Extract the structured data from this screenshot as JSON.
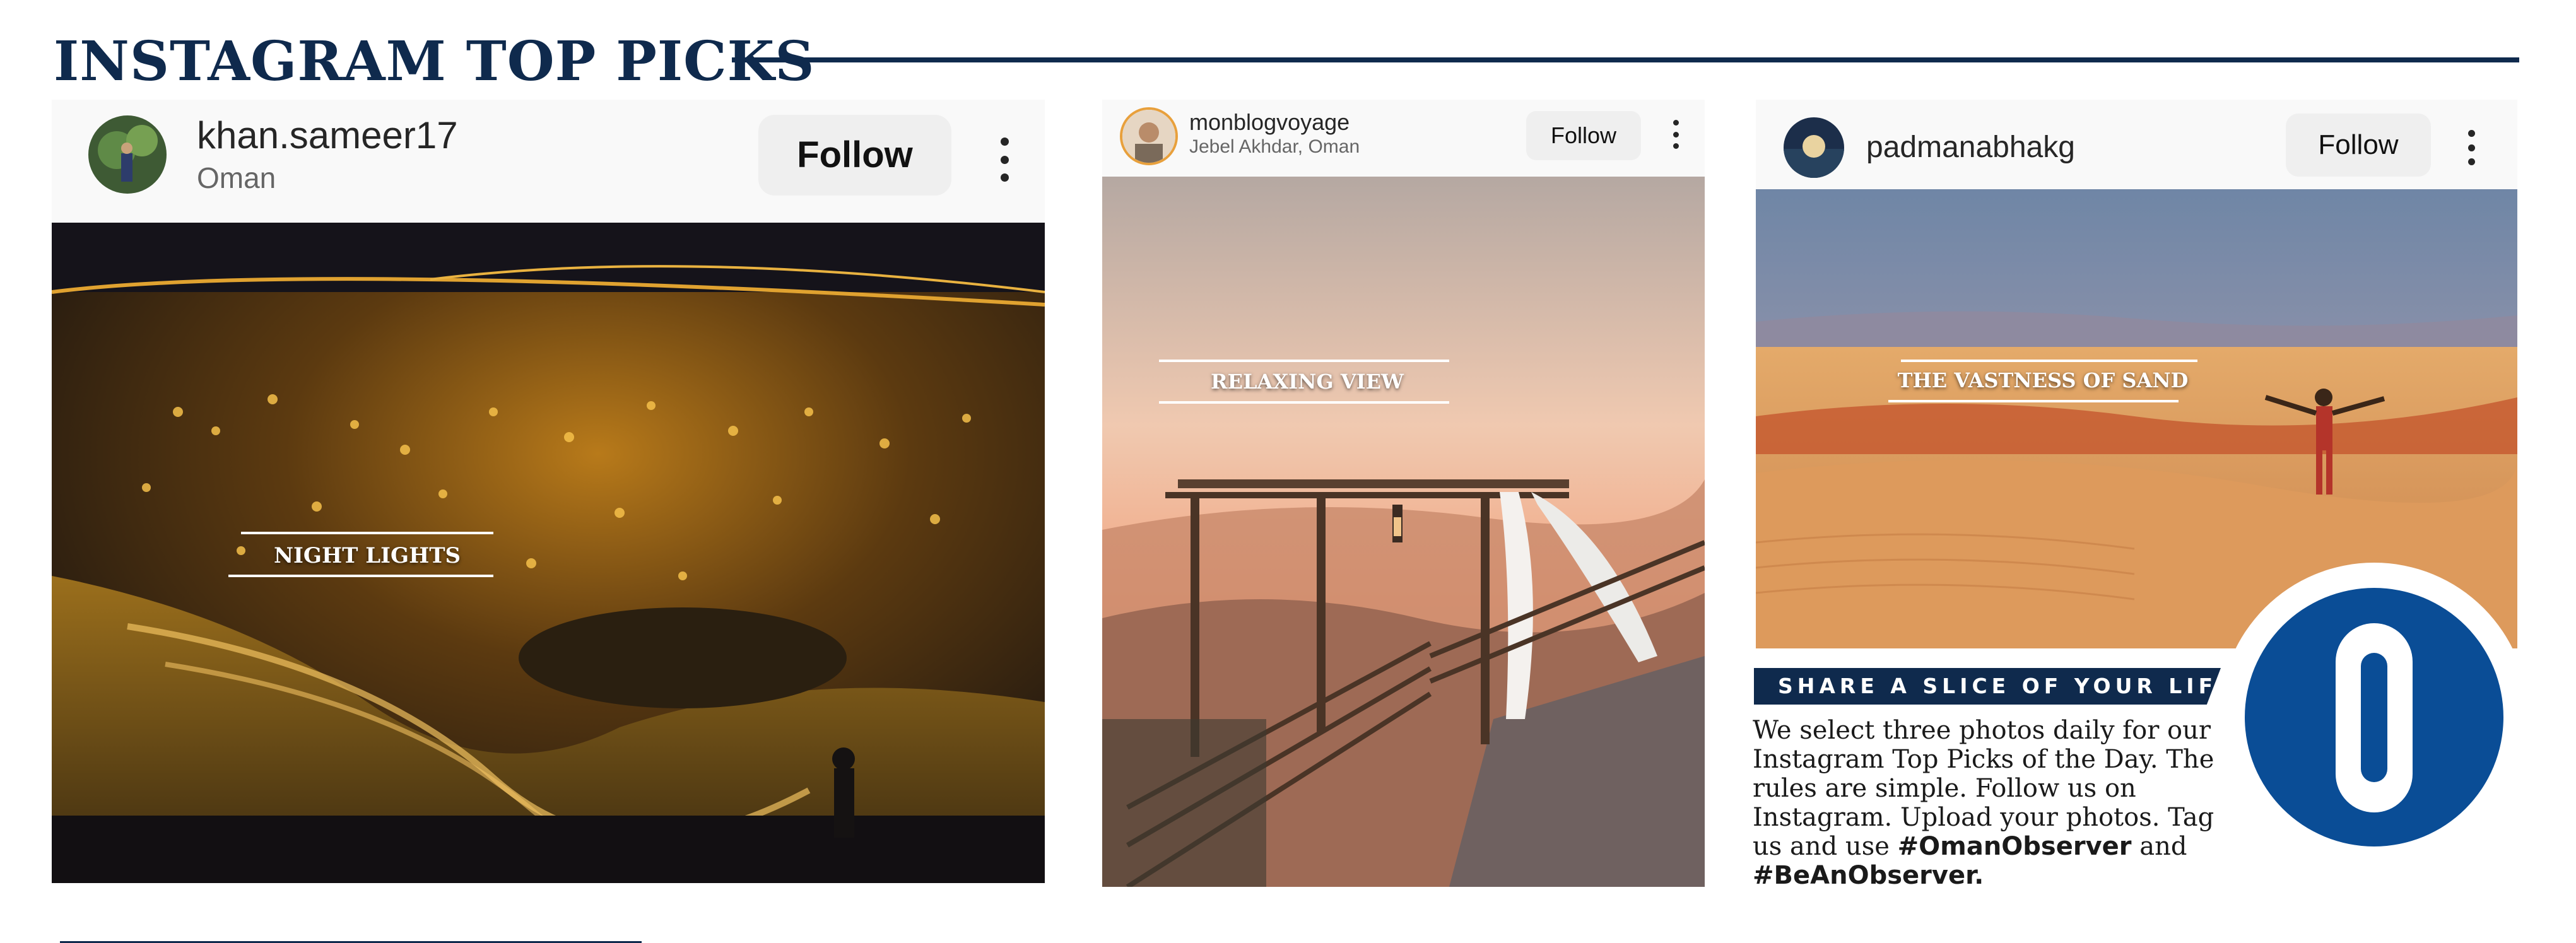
{
  "header": {
    "title": "INSTAGRAM TOP PICKS"
  },
  "posts": [
    {
      "username": "khan.sameer17",
      "location": "Oman",
      "follow_label": "Follow",
      "caption": "NIGHT LIGHTS"
    },
    {
      "username": "monblogvoyage",
      "location": "Jebel Akhdar, Oman",
      "follow_label": "Follow",
      "caption": "RELAXING VIEW"
    },
    {
      "username": "padmanabhakg",
      "location": "",
      "follow_label": "Follow",
      "caption": "THE VASTNESS OF SAND"
    }
  ],
  "promo": {
    "banner": "SHARE A SLICE OF YOUR LIFE",
    "body": "We select three photos daily for our Instagram Top Picks of the Day. The rules are simple. Follow us on Instagram. Upload your photos. Tag us and use",
    "hashtag1": "#OmanObserver",
    "connector": "and",
    "hashtag2": "#BeAnObserver.",
    "logo_letter": "O"
  },
  "colors": {
    "navy": "#0f2a4d",
    "logo_blue": "#0a4d96",
    "follow_bg": "#efefef"
  },
  "icons": [
    "more-options-icon",
    "avatar"
  ]
}
